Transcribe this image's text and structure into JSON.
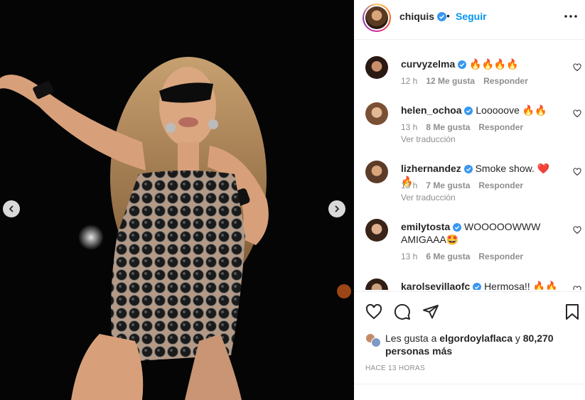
{
  "post": {
    "author": "chiquis",
    "follow_label": "Seguir",
    "separator": "•"
  },
  "comments": [
    {
      "user": "curvyzelma",
      "text": "🔥🔥🔥🔥",
      "time": "12 h",
      "likes": "12 Me gusta",
      "reply": "Responder",
      "translate": ""
    },
    {
      "user": "helen_ochoa",
      "text": "Looooove 🔥🔥",
      "time": "13 h",
      "likes": "8 Me gusta",
      "reply": "Responder",
      "translate": "Ver traducción"
    },
    {
      "user": "lizhernandez",
      "text": "Smoke show. ❤️🔥",
      "time": "13 h",
      "likes": "7 Me gusta",
      "reply": "Responder",
      "translate": "Ver traducción"
    },
    {
      "user": "emilytosta",
      "text": "WOOOOOWWW AMIGAAA🤩",
      "time": "13 h",
      "likes": "6 Me gusta",
      "reply": "Responder",
      "translate": ""
    },
    {
      "user": "karolsevillaofc",
      "text": "Hermosa!! 🔥🔥",
      "time": "",
      "likes": "",
      "reply": "",
      "translate": ""
    }
  ],
  "likes": {
    "prefix": "Les gusta a",
    "user": "elgordoylaflaca",
    "suffix": "y",
    "count": "80,270 personas más"
  },
  "time_ago": "HACE 13 HORAS",
  "icons": {
    "prev": "chevron-left-icon",
    "next": "chevron-right-icon",
    "like": "heart-icon",
    "comment": "comment-icon",
    "share": "send-icon",
    "save": "bookmark-icon",
    "more": "more-horizontal-icon"
  },
  "colors": {
    "verified": "#3897f0",
    "follow": "#0095f6",
    "muted": "#8e8e8e"
  }
}
